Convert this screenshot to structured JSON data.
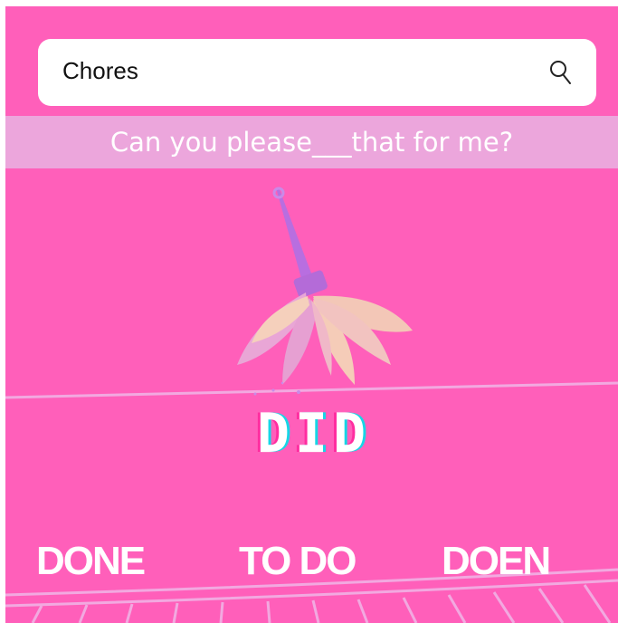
{
  "search": {
    "value": "Chores",
    "icon": "search-icon"
  },
  "prompt": {
    "text": "Can you please___that for me?"
  },
  "illustration": {
    "icon": "feather-duster-icon"
  },
  "logo": {
    "text": "DID"
  },
  "options": [
    {
      "label": "DONE"
    },
    {
      "label": "TO DO"
    },
    {
      "label": "DOEN"
    }
  ],
  "colors": {
    "background": "#ff5fba",
    "band": "#eca6dc",
    "duster_handle": "#b86ee0",
    "duster_feathers": "#f7c9b8",
    "accent_cyan": "#16d6e6"
  }
}
